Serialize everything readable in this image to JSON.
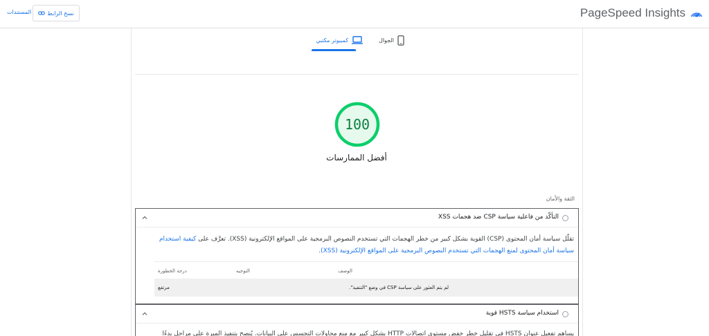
{
  "header": {
    "brand_name": "PageSpeed Insights",
    "copy_link_label": "نسخ الرابط",
    "docs_label": "المستندات",
    "accent_color": "#1a73e8"
  },
  "tabs": [
    {
      "label": "الجوال",
      "icon": "smartphone-icon",
      "selected": false
    },
    {
      "label": "كمبيوتر مكتبي",
      "icon": "laptop-icon",
      "selected": true
    }
  ],
  "score": {
    "value": "100",
    "fraction": 1.0,
    "category": "أفضل الممارسات",
    "color": "#0cce6b"
  },
  "group_title": "الثقة والأمان",
  "audits": [
    {
      "title": "التأكّد من فاعلية سياسة CSP ضد هجمات XSS",
      "description_lines": [
        "تقلّل سياسة أمان المحتوى (CSP) القوية بشكل كبير من خطر الهجمات التي تستخدم النصوص البرمجية على المواقع الإلكترونية (XSS). تعرَّف على",
        "كيفية استخدام سياسة أمان المحتوى لمنع الهجمات التي تستخدم النصوص البرمجية على المواقع الإلكترونية (XSS)",
        "."
      ],
      "table": {
        "headers": {
          "description": "الوصف",
          "directive": "التوجيه",
          "severity": "درجة الخطورة"
        },
        "rows": [
          {
            "description": "لم يتم العثور على سياسة CSP في وضع \"التنفيذ\".",
            "directive": "",
            "severity": "مرتفع"
          }
        ]
      }
    },
    {
      "title": "استخدام سياسة HSTS قوية",
      "description_lines": [
        "يساهم تفعيل عنوان HSTS في تقليل خطر خفض مستوى اتصالات HTTP بشكل كبير مع منع محاولات التجسس على البيانات. يُنصح بتنفيذ المبرة على مراحل بدءًا"
      ]
    }
  ]
}
